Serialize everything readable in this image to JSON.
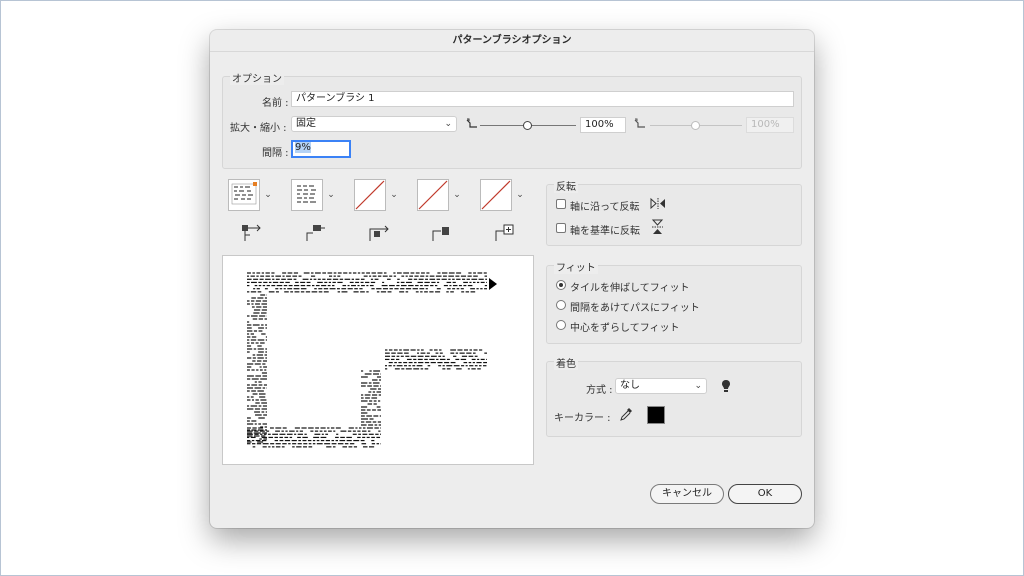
{
  "dialog": {
    "title": "パターンブラシオプション"
  },
  "options": {
    "group_label": "オプション",
    "name_label": "名前 :",
    "name_value": "パターンブラシ 1",
    "scale_label": "拡大・縮小 :",
    "scale_select": "固定",
    "scale_percent": "100%",
    "scale_percent2": "100%",
    "scale_slider_position": 0.5,
    "spacing_label": "間隔 :",
    "spacing_value": "9%"
  },
  "tiles": {
    "buttons": [
      "side-tile",
      "outer-corner-tile",
      "inner-corner-tile",
      "start-tile",
      "end-tile"
    ]
  },
  "flip": {
    "group_label": "反転",
    "flip_along": "軸に沿って反転",
    "flip_across": "軸を基準に反転"
  },
  "fit": {
    "group_label": "フィット",
    "options": [
      "タイルを伸ばしてフィット",
      "間隔をあけてパスにフィット",
      "中心をずらしてフィット"
    ],
    "selected_index": 0
  },
  "colorization": {
    "group_label": "着色",
    "method_label": "方式 :",
    "method_value": "なし",
    "key_color_label": "キーカラー :",
    "key_color": "#000000"
  },
  "buttons": {
    "cancel": "キャンセル",
    "ok": "OK"
  },
  "colors": {
    "focus": "#3b82f6",
    "selection": "#b4d2f5",
    "none_slash": "#c0392b"
  }
}
